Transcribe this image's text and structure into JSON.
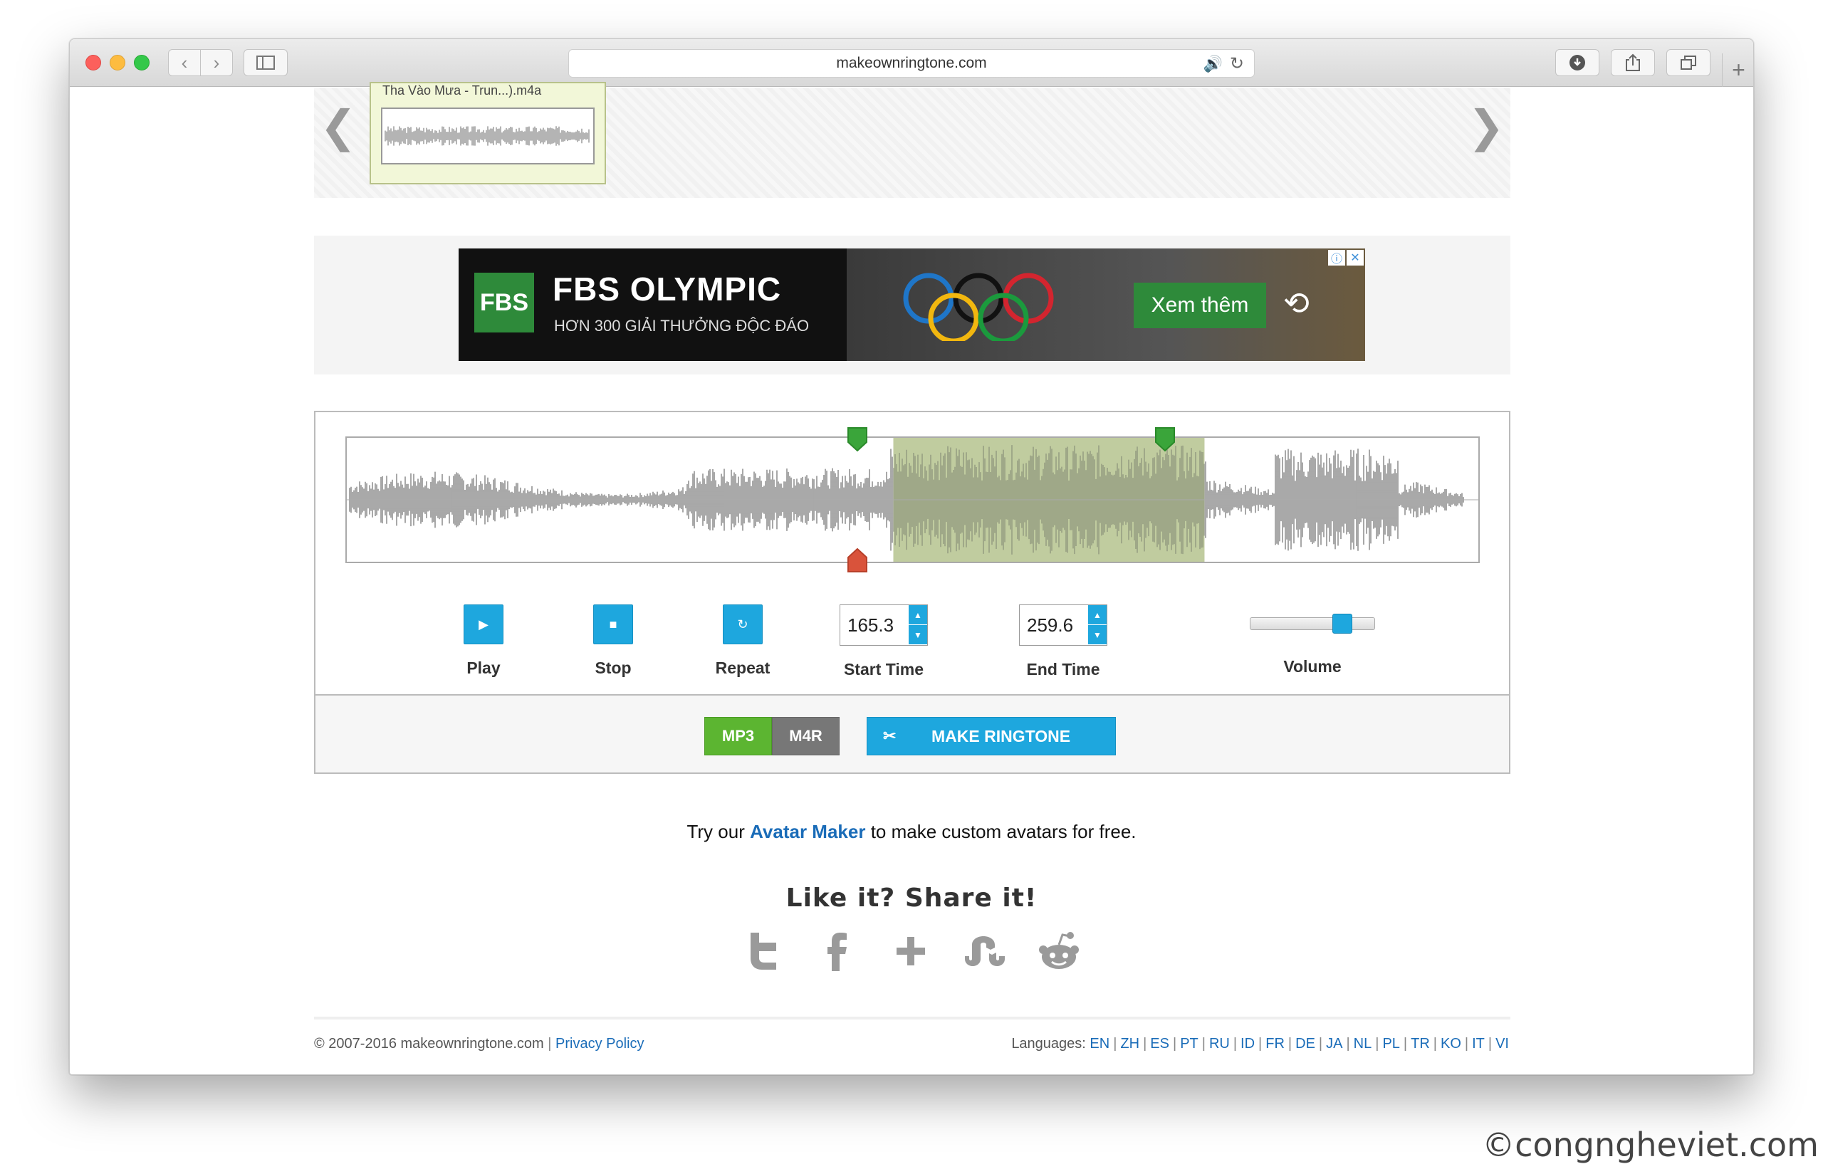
{
  "browser": {
    "url": "makeownringtone.com"
  },
  "gallery": {
    "card_title": "Tha Vào Mưa - Trun...).m4a"
  },
  "ad": {
    "logo": "FBS",
    "title": "FBS OLYMPIC",
    "subtitle": "HƠN 300 GIẢI THƯỞNG ĐỘC ĐÁO",
    "cta": "Xem thêm",
    "colors": {
      "brand_green": "#2e8a3a"
    }
  },
  "editor": {
    "selection": {
      "start_fraction": 0.483,
      "end_fraction": 0.758
    },
    "controls": {
      "play_label": "Play",
      "stop_label": "Stop",
      "repeat_label": "Repeat",
      "start_time_label": "Start Time",
      "start_time_value": "165.3",
      "end_time_label": "End Time",
      "end_time_value": "259.6",
      "volume_label": "Volume",
      "volume_level": 0.78
    },
    "format": {
      "mp3": "MP3",
      "m4r": "M4R",
      "selected": "MP3"
    },
    "make_button": "MAKE RINGTONE",
    "colors": {
      "accent": "#1ea7de",
      "mp3_green": "#5cb531",
      "selection": "#9aaa78",
      "marker_green": "#3aa53a",
      "marker_red": "#d9533b"
    }
  },
  "promo": {
    "prefix": "Try our",
    "link": "Avatar Maker",
    "suffix": "to make custom avatars for free."
  },
  "share": {
    "title": "Like it? Share it!",
    "icons": [
      "twitter-icon",
      "facebook-icon",
      "google-plus-icon",
      "stumbleupon-icon",
      "reddit-icon"
    ]
  },
  "footer": {
    "copyright": "© 2007-2016 makeownringtone.com",
    "privacy": "Privacy Policy",
    "languages_label": "Languages:",
    "languages": [
      "EN",
      "ZH",
      "ES",
      "PT",
      "RU",
      "ID",
      "FR",
      "DE",
      "JA",
      "NL",
      "PL",
      "TR",
      "KO",
      "IT",
      "VI"
    ]
  },
  "watermark": "©congngheviet.com"
}
